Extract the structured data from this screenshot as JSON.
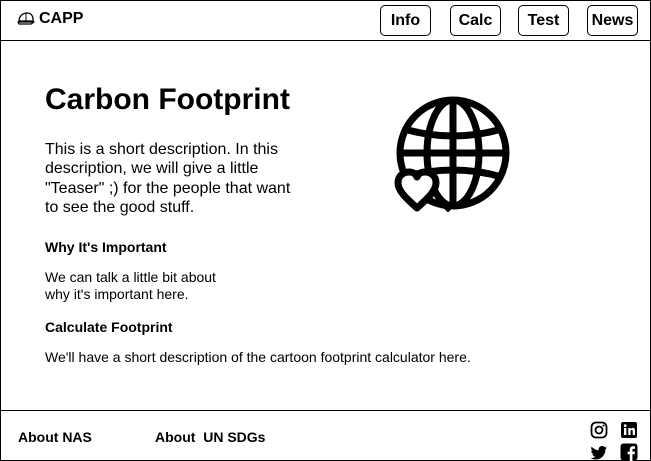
{
  "header": {
    "brand": "CAPP",
    "nav": [
      {
        "label": "Info"
      },
      {
        "label": "Calc"
      },
      {
        "label": "Test"
      },
      {
        "label": "News"
      }
    ]
  },
  "main": {
    "title": "Carbon Footprint",
    "intro": "This is a short description. In this description, we will give a little \"Teaser\" ;) for the people that want to see the good stuff.",
    "sections": [
      {
        "heading": "Why It's Important",
        "text": "We can talk a little bit about why it's important here."
      },
      {
        "heading": "Calculate Footprint",
        "text": "We'll have a short description of the cartoon footprint calculator here."
      }
    ],
    "hero_icon": "globe-heart-icon"
  },
  "footer": {
    "links": [
      {
        "label": "About NAS"
      },
      {
        "label": "About  UN SDGs"
      }
    ],
    "social_icons": [
      "instagram-icon",
      "linkedin-icon",
      "twitter-icon",
      "facebook-icon"
    ]
  },
  "colors": {
    "foreground": "#000000",
    "background": "#ffffff"
  }
}
